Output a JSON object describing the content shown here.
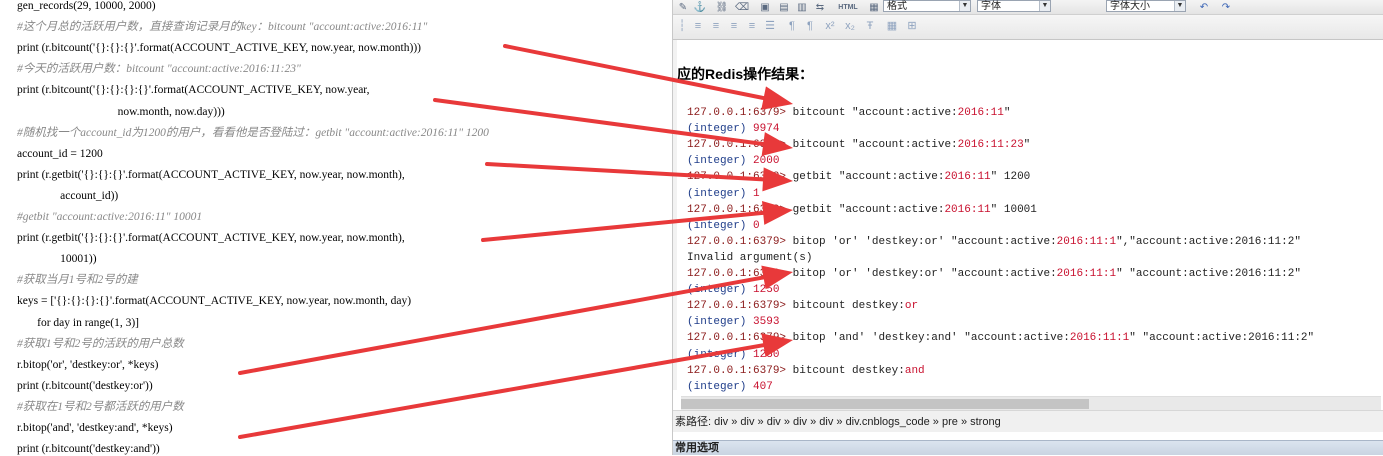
{
  "code": {
    "lines": [
      {
        "t": "gen_records(29, 10000, 2000)",
        "c": false
      },
      {
        "t": "#这个月总的活跃用户数，直接查询记录月的key：bitcount \"account:active:2016:11\"",
        "c": true
      },
      {
        "t": "print (r.bitcount('{}:{}:{}'.format(ACCOUNT_ACTIVE_KEY, now.year, now.month)))",
        "c": false
      },
      {
        "t": "#今天的活跃用户数：bitcount \"account:active:2016:11:23\"",
        "c": true
      },
      {
        "t": "print (r.bitcount('{}:{}:{}:{}'.format(ACCOUNT_ACTIVE_KEY, now.year,",
        "c": false
      },
      {
        "t": "                                   now.month, now.day)))",
        "c": false
      },
      {
        "t": "#随机找一个account_id为1200的用户，看看他是否登陆过：getbit \"account:active:2016:11\" 1200",
        "c": true
      },
      {
        "t": "account_id = 1200",
        "c": false
      },
      {
        "t": "print (r.getbit('{}:{}:{}'.format(ACCOUNT_ACTIVE_KEY, now.year, now.month),",
        "c": false
      },
      {
        "t": "               account_id))",
        "c": false
      },
      {
        "t": "#getbit \"account:active:2016:11\" 10001",
        "c": true
      },
      {
        "t": "print (r.getbit('{}:{}:{}'.format(ACCOUNT_ACTIVE_KEY, now.year, now.month),",
        "c": false
      },
      {
        "t": "               10001))",
        "c": false
      },
      {
        "t": "#获取当月1号和2号的建",
        "c": true
      },
      {
        "t": "keys = ['{}:{}:{}:{}'.format(ACCOUNT_ACTIVE_KEY, now.year, now.month, day)",
        "c": false
      },
      {
        "t": "       for day in range(1, 3)]",
        "c": false
      },
      {
        "t": "#获取1号和2号的活跃的用户总数",
        "c": true
      },
      {
        "t": "r.bitop('or', 'destkey:or', *keys)",
        "c": false
      },
      {
        "t": "print (r.bitcount('destkey:or'))",
        "c": false
      },
      {
        "t": "#获取在1号和2号都活跃的用户数",
        "c": true
      },
      {
        "t": "r.bitop('and', 'destkey:and', *keys)",
        "c": false
      },
      {
        "t": "print (r.bitcount('destkey:and'))",
        "c": false
      }
    ]
  },
  "editor": {
    "toolbar": {
      "format_select": "格式",
      "font_select": "字体",
      "size_select": "字体大小",
      "html_label": "HTML"
    },
    "section_title": "应的Redis操作结果：",
    "terminal": [
      {
        "prompt": "127.0.0.1:6379> ",
        "cmd": "bitcount \"account:active:",
        "hl": "2016:11",
        "tail": "\""
      },
      {
        "integer": "(integer) ",
        "val": "9974"
      },
      {
        "prompt": "127.0.0.1:6379> ",
        "cmd": "bitcount \"account:active:",
        "hl": "2016:11:23",
        "tail": "\""
      },
      {
        "integer": "(integer) ",
        "val": "2000"
      },
      {
        "prompt": "127.0.0.1:6379> ",
        "cmd": "getbit \"account:active:",
        "hl": "2016:11",
        "tail": "\" 1200"
      },
      {
        "integer": "(integer) ",
        "val": "1"
      },
      {
        "prompt": "127.0.0.1:6379> ",
        "cmd": "getbit \"account:active:",
        "hl": "2016:11",
        "tail": "\" 10001"
      },
      {
        "integer": "(integer) ",
        "val": "0"
      },
      {
        "prompt": "127.0.0.1:6379> ",
        "cmd": "bitop 'or' 'destkey:or' \"account:active:",
        "hl": "2016:11:1",
        "tail": "\",\"account:active:2016:11:2\""
      },
      {
        "plain": "Invalid argument(s)"
      },
      {
        "prompt": "127.0.0.1:6379> ",
        "cmd": "bitop 'or' 'destkey:or' \"account:active:",
        "hl": "2016:11:1",
        "tail": "\" \"account:active:2016:11:2\""
      },
      {
        "integer": "(integer) ",
        "val": "1250"
      },
      {
        "prompt": "127.0.0.1:6379> ",
        "cmd": "bitcount destkey:",
        "hl": "or",
        "tail": ""
      },
      {
        "integer": "(integer) ",
        "val": "3593"
      },
      {
        "prompt": "127.0.0.1:6379> ",
        "cmd": "bitop 'and' 'destkey:and' \"account:active:",
        "hl": "2016:11:1",
        "tail": "\" \"account:active:2016:11:2\""
      },
      {
        "integer": "(integer) ",
        "val": "1250"
      },
      {
        "prompt": "127.0.0.1:6379> ",
        "cmd": "bitcount destkey:",
        "hl": "and",
        "tail": ""
      },
      {
        "integer": "(integer) ",
        "val": "407"
      }
    ],
    "breadcrumb": "素路径: div » div » div » div » div » div.cnblogs_code » pre » strong",
    "options_label": "常用选项"
  },
  "colors": {
    "arrow": "#e8393a",
    "prompt": "#8b1a1a",
    "integer": "#1f3d8a",
    "highlight": "#c8102e"
  }
}
